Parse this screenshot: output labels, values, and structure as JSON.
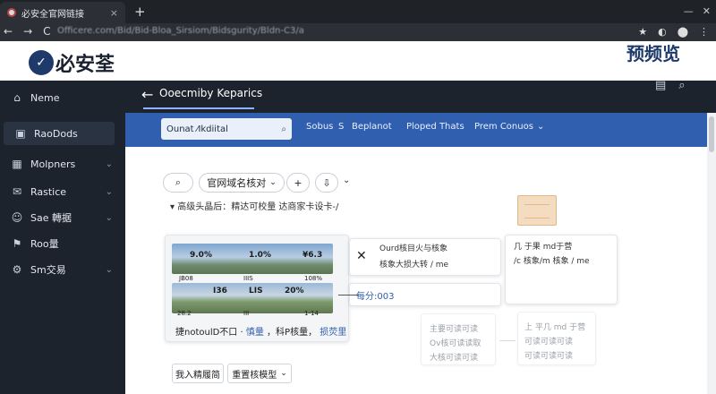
{
  "browser": {
    "tab_title": "必安全官网链接",
    "tab_close": "×",
    "new_tab": "+",
    "url": "Officere.com/Bid/Bid-Bloa_Sirsiom/Bidsgurity/Bldn-C3/a",
    "nav": [
      "←",
      "→",
      "C"
    ],
    "right_icons": [
      "★",
      "◐",
      "⬤",
      "⋮"
    ]
  },
  "header": {
    "logo_mark": "✓",
    "logo_text": "必安荃",
    "right_text": "预频览"
  },
  "sidebar": {
    "items": [
      {
        "icon": "⌂",
        "label": "Neme",
        "chevron": ""
      },
      {
        "icon": "▣",
        "label": "RaoDods",
        "chevron": "",
        "active": true
      },
      {
        "icon": "▦",
        "label": "Molpners",
        "chevron": "⌄"
      },
      {
        "icon": "✉",
        "label": "Rastice",
        "chevron": "⌄"
      },
      {
        "icon": "☺",
        "label": "Sae 轉据",
        "chevron": "⌄"
      },
      {
        "icon": "⚑",
        "label": "Roo量",
        "chevron": ""
      },
      {
        "icon": "⚙",
        "label": "Sm交易",
        "chevron": "⌄"
      }
    ]
  },
  "topbar": {
    "back": "←",
    "title": "Ooecmiby Keparics",
    "right_icons": [
      "▤",
      "⌕"
    ]
  },
  "filters": {
    "search_value": "Ounat ⁄Ikdiital",
    "search_icon": "⌕",
    "labels": [
      "Sobus",
      "S",
      "Beplanot",
      "Ploped Thats",
      "Prem Conuos"
    ],
    "chevron": "⌄"
  },
  "toolbar": {
    "search_icon": "⌕",
    "domain_button": "官网域名核对",
    "domain_chevron": "⌄",
    "add_button": "+",
    "upload_icon": "⇩",
    "more_chevron": "⌄",
    "hint": "▾  高级头晶后：精达可校量  达商家卡设卡-/"
  },
  "cards": {
    "thumb1_labels": [
      "9.0%",
      "1.0%",
      "¥6.3"
    ],
    "thumb1_small": [
      "JB08",
      "IIIS",
      "108%"
    ],
    "thumb2_labels": [
      "I36",
      "LIS",
      "20%"
    ],
    "thumb2_small": [
      "28.2",
      "III",
      "1-14"
    ],
    "caption_plain1": "捷notoulD不口 ·",
    "caption_blue1": "慎量",
    "caption_plain2": "，科P核量，",
    "caption_blue2": "损荧里",
    "x_card_icon": "✕",
    "x_card_line1": "Ourd核目火与核象",
    "x_card_line2": "核象大损大转 / me",
    "arrow_card_text": "每分:003",
    "text_card_line1": "几 于果 md于营",
    "text_card_line2": "/c 核象/m 核象 / me",
    "faint_card1_line1": "主要可读可读",
    "faint_card1_line2": "Ov核可读读取",
    "faint_card1_line3": "大核可读可读",
    "faint_card2_line1": "上 平几 md 于营",
    "faint_card2_line2": "可读可读可读",
    "faint_card2_line3": "可读可读可读"
  },
  "bottom": {
    "button1": "我入精履简",
    "button2": "重置核模型",
    "button2_chevron": "⌄"
  }
}
